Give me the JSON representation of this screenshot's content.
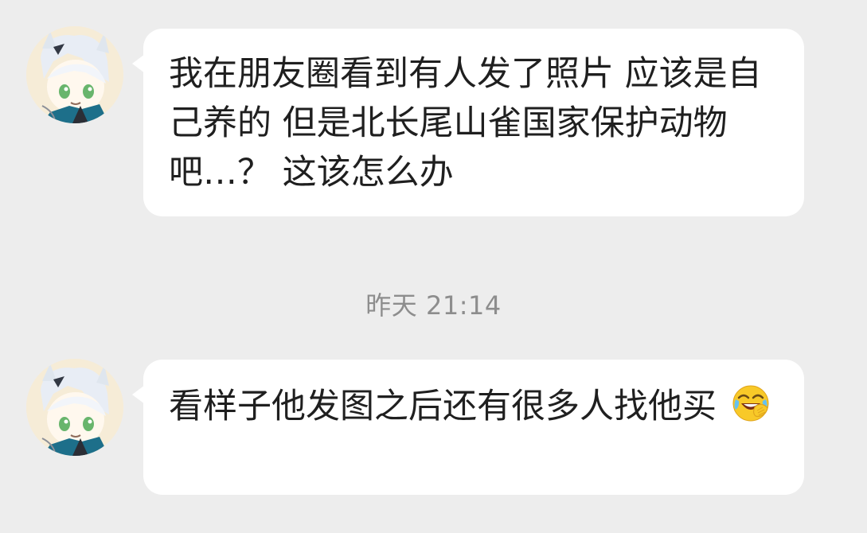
{
  "conversation": {
    "messages": [
      {
        "text": "我在朋友圈看到有人发了照片 应该是自己养的 但是北长尾山雀国家保护动物吧…？ 这该怎么办"
      },
      {
        "text": "看样子他发图之后还有很多人找他买",
        "emoji": "laughing-crying-face-icon"
      }
    ],
    "timestamp": "昨天 21:14"
  }
}
